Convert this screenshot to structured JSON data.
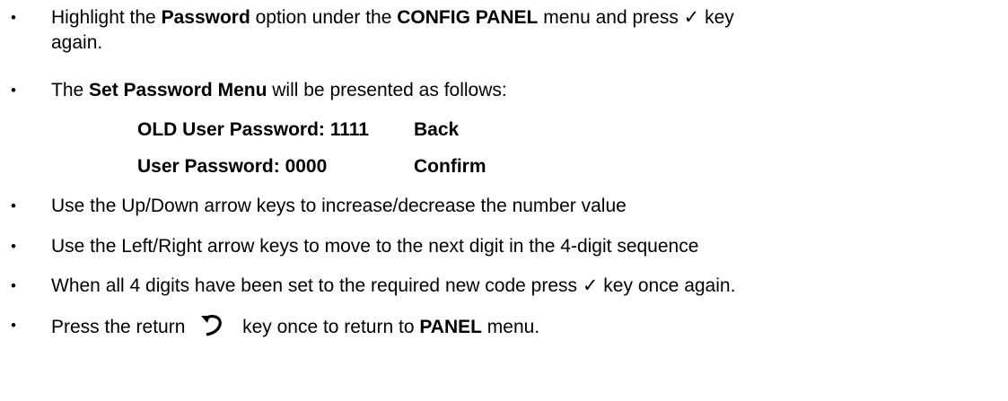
{
  "items": [
    {
      "p1": "Highlight the ",
      "b1": "Password",
      "p2": " option under the ",
      "b2": "CONFIG PANEL",
      "p3": " menu and press ",
      "check": "✓",
      "p4": " key",
      "p5": "again."
    },
    {
      "p1": "The ",
      "b1": "Set Password Menu",
      "p2": " will be presented as follows:"
    },
    {
      "text": "Use the Up/Down arrow keys to increase/decrease the number value"
    },
    {
      "text": "Use the Left/Right arrow keys to move to the next digit in the 4-digit sequence"
    },
    {
      "p1": "When all 4 digits have been set to the required new code press ",
      "check": "✓",
      "p2": " key once again."
    },
    {
      "p1": "Press the return ",
      "icon": "return-arrow-icon",
      "p2": " key once to return to ",
      "b1": "PANEL",
      "p3": " menu."
    }
  ],
  "menu": {
    "row1_label": "OLD User Password: 1111",
    "row1_option": "Back",
    "row2_label": "User Password: 0000",
    "row2_option": "Confirm"
  },
  "bullet": "•"
}
